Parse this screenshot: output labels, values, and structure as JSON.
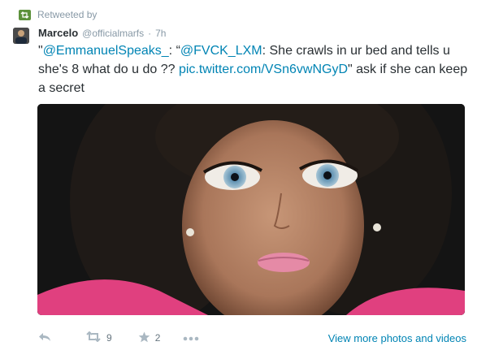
{
  "retweeted_by_label": "Retweeted by",
  "tweet": {
    "author_name": "Marcelo",
    "author_handle": "@officialmarfs",
    "separator": "·",
    "time": "7h",
    "text": {
      "open_quote": "\"",
      "mention_1": "@EmmanuelSpeaks_",
      "part_1": ": “",
      "mention_2": "@FVCK_LXM",
      "part_2": ": She crawls in ur bed and tells u she's 8 what do u do ?? ",
      "pic_link": "pic.twitter.com/VSn6vwNGyD",
      "part_3": "\" ask if she can keep a secret"
    }
  },
  "actions": {
    "retweet_count": "9",
    "favorite_count": "2",
    "view_more_label": "View more photos and videos"
  },
  "colors": {
    "link": "#0084b4",
    "retweet_icon": "#5c913b",
    "muted": "#8899a6"
  }
}
